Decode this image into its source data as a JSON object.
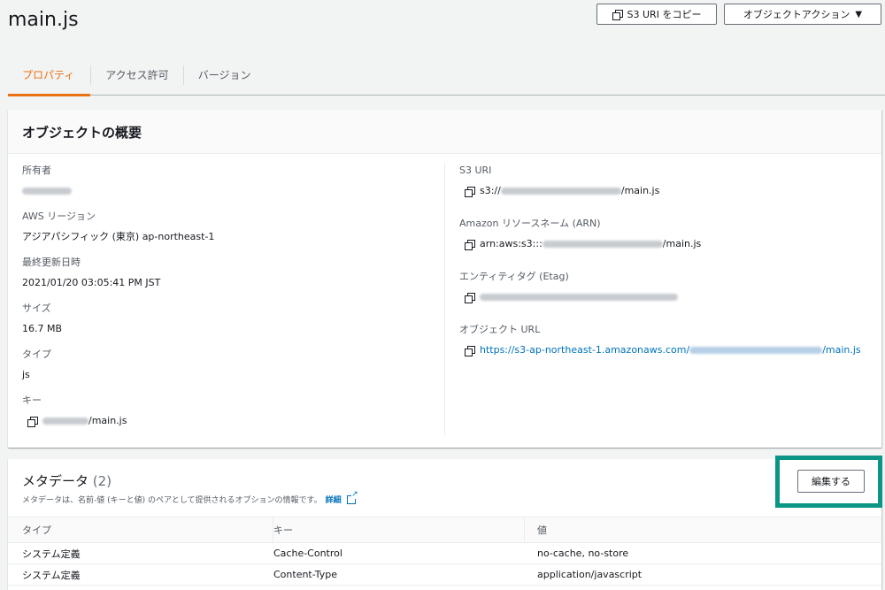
{
  "header": {
    "title": "main.js",
    "copy_uri_label": "S3 URI をコピー",
    "actions_label": "オブジェクトアクション",
    "actions_caret": "▼"
  },
  "tabs": [
    {
      "label": "プロパティ",
      "active": true
    },
    {
      "label": "アクセス許可",
      "active": false
    },
    {
      "label": "バージョン",
      "active": false
    }
  ],
  "summary": {
    "title": "オブジェクトの概要",
    "owner": {
      "label": "所有者"
    },
    "region": {
      "label": "AWS リージョン",
      "value": "アジアパシフィック (東京) ap-northeast-1"
    },
    "last_modified": {
      "label": "最終更新日時",
      "value": "2021/01/20 03:05:41 PM JST"
    },
    "size": {
      "label": "サイズ",
      "value": "16.7 MB"
    },
    "type": {
      "label": "タイプ",
      "value": "js"
    },
    "key": {
      "label": "キー",
      "suffix": "/main.js"
    },
    "s3_uri": {
      "label": "S3 URI",
      "prefix": "s3://",
      "suffix": "/main.js"
    },
    "arn": {
      "label": "Amazon リソースネーム (ARN)",
      "prefix": "arn:aws:s3:::",
      "suffix": "/main.js"
    },
    "etag": {
      "label": "エンティティタグ (Etag)"
    },
    "object_url": {
      "label": "オブジェクト URL",
      "prefix": "https://s3-ap-northeast-1.amazonaws.com/",
      "suffix": "/main.js"
    }
  },
  "metadata": {
    "title": "メタデータ",
    "count": "(2)",
    "description": "メタデータは、名前-値 (キーと値) のペアとして提供されるオプションの情報です。",
    "detail_link": "詳細",
    "edit_label": "編集する",
    "columns": [
      "タイプ",
      "キー",
      "値"
    ],
    "rows": [
      {
        "type": "システム定義",
        "key": "Cache-Control",
        "value": "no-cache, no-store"
      },
      {
        "type": "システム定義",
        "key": "Content-Type",
        "value": "application/javascript"
      }
    ]
  },
  "colors": {
    "accent": "#ec7211",
    "link": "#0073bb",
    "highlight": "#0a9584"
  }
}
